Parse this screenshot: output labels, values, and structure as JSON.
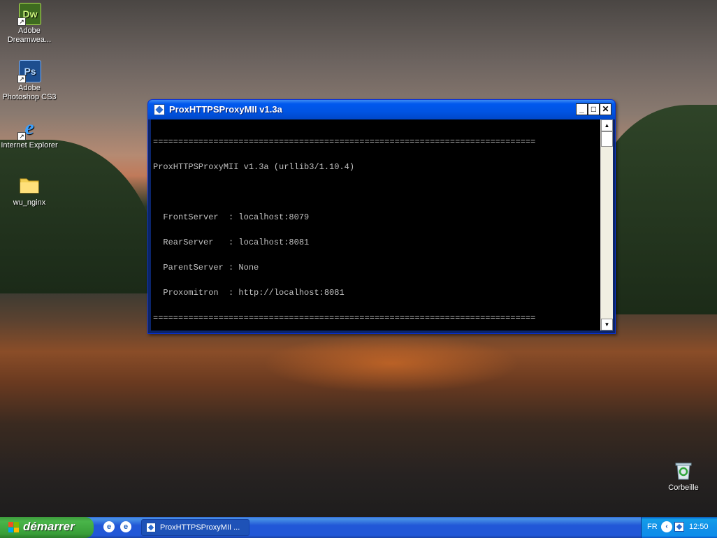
{
  "desktop": {
    "icons": [
      {
        "label": "Adobe Dreamwea...",
        "glyph": "Dw",
        "icon": "dreamweaver-icon"
      },
      {
        "label": "Adobe Photoshop CS3",
        "glyph": "Ps",
        "icon": "photoshop-icon"
      },
      {
        "label": "Internet Explorer",
        "glyph": "e",
        "icon": "internet-explorer-icon"
      },
      {
        "label": "wu_nginx",
        "icon": "folder-icon"
      },
      {
        "label": "Corbeille",
        "icon": "recycle-bin-icon"
      }
    ]
  },
  "window": {
    "title": "ProxHTTPSProxyMII v1.3a",
    "buttons": {
      "minimize": "_",
      "maximize": "□",
      "close": "✕"
    },
    "console": {
      "lines": [
        "============================================================================",
        "ProxHTTPSProxyMII v1.3a (urllib3/1.10.4)",
        "",
        "  FrontServer  : localhost:8079",
        "  RearServer   : localhost:8081",
        "  ParentServer : None",
        "  Proxomitron  : http://localhost:8081",
        "============================================================================"
      ]
    }
  },
  "taskbar": {
    "start_label": "démarrer",
    "task_label": "ProxHTTPSProxyMII ...",
    "language": "FR",
    "clock": "12:50"
  },
  "colors": {
    "console_bg": "#000000",
    "console_text": "#c0c0c0",
    "titlebar": "#0054e3",
    "start_button": "#3c9a3c"
  }
}
